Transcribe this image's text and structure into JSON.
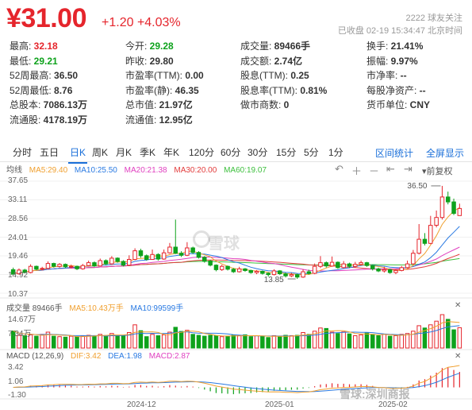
{
  "quote": {
    "price": "¥31.00",
    "change": "+1.20",
    "change_pct": "+4.03%",
    "followers": "2222 球友关注",
    "status": "已收盘 02-19 15:34:47 北京时间"
  },
  "stats": [
    {
      "label": "最高:",
      "value": "32.18",
      "color": "red"
    },
    {
      "label": "今开:",
      "value": "29.28",
      "color": "green"
    },
    {
      "label": "成交量:",
      "value": "89466手"
    },
    {
      "label": "换手:",
      "value": "21.41%"
    },
    {
      "label": "最低:",
      "value": "29.21",
      "color": "green"
    },
    {
      "label": "昨收:",
      "value": "29.80"
    },
    {
      "label": "成交额:",
      "value": "2.74亿"
    },
    {
      "label": "振幅:",
      "value": "9.97%"
    },
    {
      "label": "52周最高:",
      "value": "36.50"
    },
    {
      "label": "市盈率(TTM):",
      "value": "0.00"
    },
    {
      "label": "股息(TTM):",
      "value": "0.25"
    },
    {
      "label": "市净率:",
      "value": "--"
    },
    {
      "label": "52周最低:",
      "value": "8.76"
    },
    {
      "label": "市盈率(静):",
      "value": "46.35"
    },
    {
      "label": "股息率(TTM):",
      "value": "0.81%"
    },
    {
      "label": "每股净资产:",
      "value": "--"
    },
    {
      "label": "总股本:",
      "value": "7086.13万"
    },
    {
      "label": "总市值:",
      "value": "21.97亿"
    },
    {
      "label": "做市商数:",
      "value": "0"
    },
    {
      "label": "货币单位:",
      "value": "CNY"
    },
    {
      "label": "流通股:",
      "value": "4178.19万"
    },
    {
      "label": "流通值:",
      "value": "12.95亿"
    }
  ],
  "tabs": [
    "分时",
    "五日",
    "日K",
    "周K",
    "月K",
    "季K",
    "年K",
    "120分",
    "60分",
    "30分",
    "15分",
    "5分",
    "1分"
  ],
  "active_tab": "日K",
  "links": {
    "interval": "区间统计",
    "fullscreen": "全屏显示"
  },
  "toolbar": {
    "rights": "前复权"
  },
  "ma_legend": {
    "title": "均线",
    "items": [
      {
        "text": "MA5:29.40",
        "color": "#f0a030"
      },
      {
        "text": "MA10:25.50",
        "color": "#2a7ae2"
      },
      {
        "text": "MA20:21.38",
        "color": "#e040c0"
      },
      {
        "text": "MA30:20.00",
        "color": "#e23c3c"
      },
      {
        "text": "MA60:19.07",
        "color": "#3cbf3c"
      }
    ]
  },
  "price_axis": [
    "37.65",
    "33.11",
    "28.56",
    "24.01",
    "19.46",
    "14.92",
    "10.37"
  ],
  "price_annotations": {
    "high": "36.50",
    "low": "13.85"
  },
  "volume_legend": {
    "title": "成交量 89466手",
    "items": [
      {
        "text": "MA5:10.43万手",
        "color": "#f0a030"
      },
      {
        "text": "MA10:99599手",
        "color": "#2a7ae2"
      }
    ],
    "axis": [
      "14.67万",
      "7.34万"
    ]
  },
  "macd_legend": {
    "title": "MACD (12,26,9)",
    "items": [
      {
        "text": "DIF:3.42",
        "color": "#f0a030"
      },
      {
        "text": "DEA:1.98",
        "color": "#2a7ae2"
      },
      {
        "text": "MACD:2.87",
        "color": "#e040c0"
      }
    ],
    "axis": [
      "3.42",
      "1.06",
      "-1.30"
    ]
  },
  "x_axis": [
    "2024-12",
    "2025-01",
    "2025-02"
  ],
  "watermark": {
    "logo": "雪球",
    "bottom": "雪球:深圳商报"
  },
  "chart_data": {
    "type": "candlestick",
    "candles": [
      [
        16.1,
        15.0,
        16.6,
        14.9
      ],
      [
        15.1,
        16.0,
        16.4,
        14.9
      ],
      [
        16.0,
        15.4,
        16.3,
        15.2
      ],
      [
        15.4,
        16.9,
        17.4,
        15.2
      ],
      [
        16.9,
        16.2,
        17.1,
        16.0
      ],
      [
        16.2,
        16.4,
        16.8,
        15.9
      ],
      [
        16.4,
        17.6,
        18.1,
        16.2
      ],
      [
        17.6,
        16.9,
        17.8,
        16.6
      ],
      [
        16.9,
        17.4,
        17.7,
        16.6
      ],
      [
        17.4,
        16.8,
        17.6,
        16.5
      ],
      [
        16.8,
        16.9,
        17.3,
        16.4
      ],
      [
        16.9,
        16.3,
        17.1,
        16.0
      ],
      [
        16.3,
        17.1,
        17.5,
        16.1
      ],
      [
        17.1,
        17.8,
        18.3,
        16.9
      ],
      [
        17.8,
        17.0,
        18.1,
        16.8
      ],
      [
        17.0,
        18.3,
        18.8,
        16.9
      ],
      [
        18.3,
        17.5,
        18.6,
        17.2
      ],
      [
        17.5,
        18.9,
        19.4,
        17.3
      ],
      [
        18.9,
        18.1,
        19.1,
        17.8
      ],
      [
        18.1,
        17.2,
        18.4,
        16.9
      ],
      [
        17.2,
        18.6,
        19.6,
        17.0
      ],
      [
        18.6,
        20.7,
        21.3,
        18.4
      ],
      [
        20.7,
        19.5,
        21.2,
        19.0
      ],
      [
        19.5,
        18.6,
        19.8,
        18.3
      ],
      [
        18.6,
        19.8,
        21.0,
        18.5
      ],
      [
        19.8,
        18.7,
        20.1,
        18.3
      ],
      [
        18.7,
        20.2,
        21.0,
        18.5
      ],
      [
        20.2,
        21.6,
        22.6,
        20.0
      ],
      [
        21.6,
        20.1,
        28.3,
        19.9
      ],
      [
        20.1,
        19.6,
        20.6,
        19.2
      ],
      [
        19.6,
        21.4,
        22.8,
        19.4
      ],
      [
        21.4,
        20.3,
        21.7,
        19.9
      ],
      [
        20.3,
        19.1,
        20.6,
        18.8
      ],
      [
        19.1,
        18.2,
        19.4,
        17.8
      ],
      [
        18.2,
        17.2,
        18.5,
        16.9
      ],
      [
        17.2,
        16.1,
        17.4,
        15.7
      ],
      [
        16.1,
        16.9,
        17.3,
        15.8
      ],
      [
        16.9,
        16.2,
        17.1,
        15.9
      ],
      [
        16.2,
        15.6,
        16.5,
        15.3
      ],
      [
        15.6,
        16.3,
        16.8,
        15.4
      ],
      [
        16.3,
        15.9,
        16.5,
        15.6
      ],
      [
        15.9,
        15.4,
        16.1,
        15.1
      ],
      [
        15.4,
        15.7,
        16.0,
        15.0
      ],
      [
        15.7,
        15.2,
        15.9,
        14.9
      ],
      [
        15.2,
        14.9,
        15.5,
        14.4
      ],
      [
        14.9,
        15.8,
        16.2,
        14.7
      ],
      [
        15.8,
        15.1,
        16.0,
        14.8
      ],
      [
        15.1,
        14.6,
        15.4,
        14.2
      ],
      [
        14.6,
        14.9,
        15.3,
        14.3
      ],
      [
        14.9,
        14.3,
        15.1,
        13.85
      ],
      [
        14.3,
        15.6,
        16.2,
        14.1
      ],
      [
        15.6,
        15.2,
        16.1,
        14.9
      ],
      [
        15.2,
        16.9,
        17.6,
        15.0
      ],
      [
        16.9,
        17.8,
        19.4,
        16.5
      ],
      [
        17.8,
        17.0,
        18.1,
        16.6
      ],
      [
        17.0,
        17.9,
        19.3,
        16.8
      ],
      [
        17.9,
        16.6,
        18.1,
        16.3
      ],
      [
        16.6,
        17.5,
        18.2,
        16.4
      ],
      [
        17.5,
        16.9,
        17.8,
        16.5
      ],
      [
        16.9,
        17.4,
        18.0,
        16.6
      ],
      [
        17.4,
        17.8,
        18.3,
        17.1
      ],
      [
        17.8,
        17.1,
        18.0,
        16.8
      ],
      [
        17.1,
        16.3,
        17.3,
        15.9
      ],
      [
        16.3,
        15.8,
        16.6,
        15.5
      ],
      [
        15.8,
        16.1,
        16.8,
        15.4
      ],
      [
        16.1,
        15.4,
        16.3,
        15.1
      ],
      [
        15.4,
        15.9,
        16.2,
        15.0
      ],
      [
        15.9,
        16.6,
        17.0,
        15.7
      ],
      [
        16.6,
        17.5,
        18.3,
        16.4
      ],
      [
        17.5,
        20.1,
        20.9,
        17.3
      ],
      [
        20.1,
        23.5,
        27.2,
        19.8
      ],
      [
        23.5,
        22.5,
        25.0,
        22.0
      ],
      [
        22.5,
        26.9,
        29.2,
        22.3
      ],
      [
        26.9,
        28.8,
        30.5,
        26.4
      ],
      [
        28.8,
        33.8,
        36.5,
        28.3
      ],
      [
        33.8,
        32.6,
        35.1,
        32.0
      ],
      [
        32.6,
        29.8,
        33.4,
        29.4
      ],
      [
        29.28,
        31.0,
        32.18,
        29.21
      ]
    ],
    "volume_wan": [
      7.5,
      5.6,
      5.4,
      5.8,
      5.2,
      6.0,
      7.0,
      5.2,
      5.0,
      4.8,
      5.2,
      5.0,
      5.2,
      5.6,
      5.4,
      6.0,
      5.5,
      6.4,
      5.4,
      5.6,
      6.8,
      10.2,
      7.6,
      5.0,
      6.0,
      5.4,
      5.8,
      7.0,
      9.1,
      7.3,
      7.8,
      6.0,
      5.6,
      5.2,
      5.6,
      5.4,
      5.0,
      5.2,
      5.6,
      5.4,
      5.8,
      5.0,
      5.4,
      5.2,
      4.6,
      5.4,
      5.0,
      5.6,
      5.4,
      5.6,
      6.8,
      6.0,
      7.4,
      8.8,
      8.6,
      7.0,
      6.4,
      7.1,
      6.2,
      5.4,
      5.8,
      6.6,
      6.0,
      5.4,
      6.0,
      5.2,
      5.4,
      6.0,
      6.4,
      7.4,
      9.8,
      8.8,
      10.2,
      11.8,
      14.67,
      12.6,
      8.0,
      8.95
    ],
    "ma_final": {
      "MA5": 29.4,
      "MA10": 25.5,
      "MA20": 21.38,
      "MA30": 20.0,
      "MA60": 19.07
    },
    "macd_final": {
      "DIF": 3.42,
      "DEA": 1.98,
      "MACD": 2.87
    },
    "ylim_price": [
      10.37,
      37.65
    ],
    "ylim_volume": [
      0,
      14.67
    ],
    "ylim_macd": [
      -1.3,
      3.42
    ]
  }
}
